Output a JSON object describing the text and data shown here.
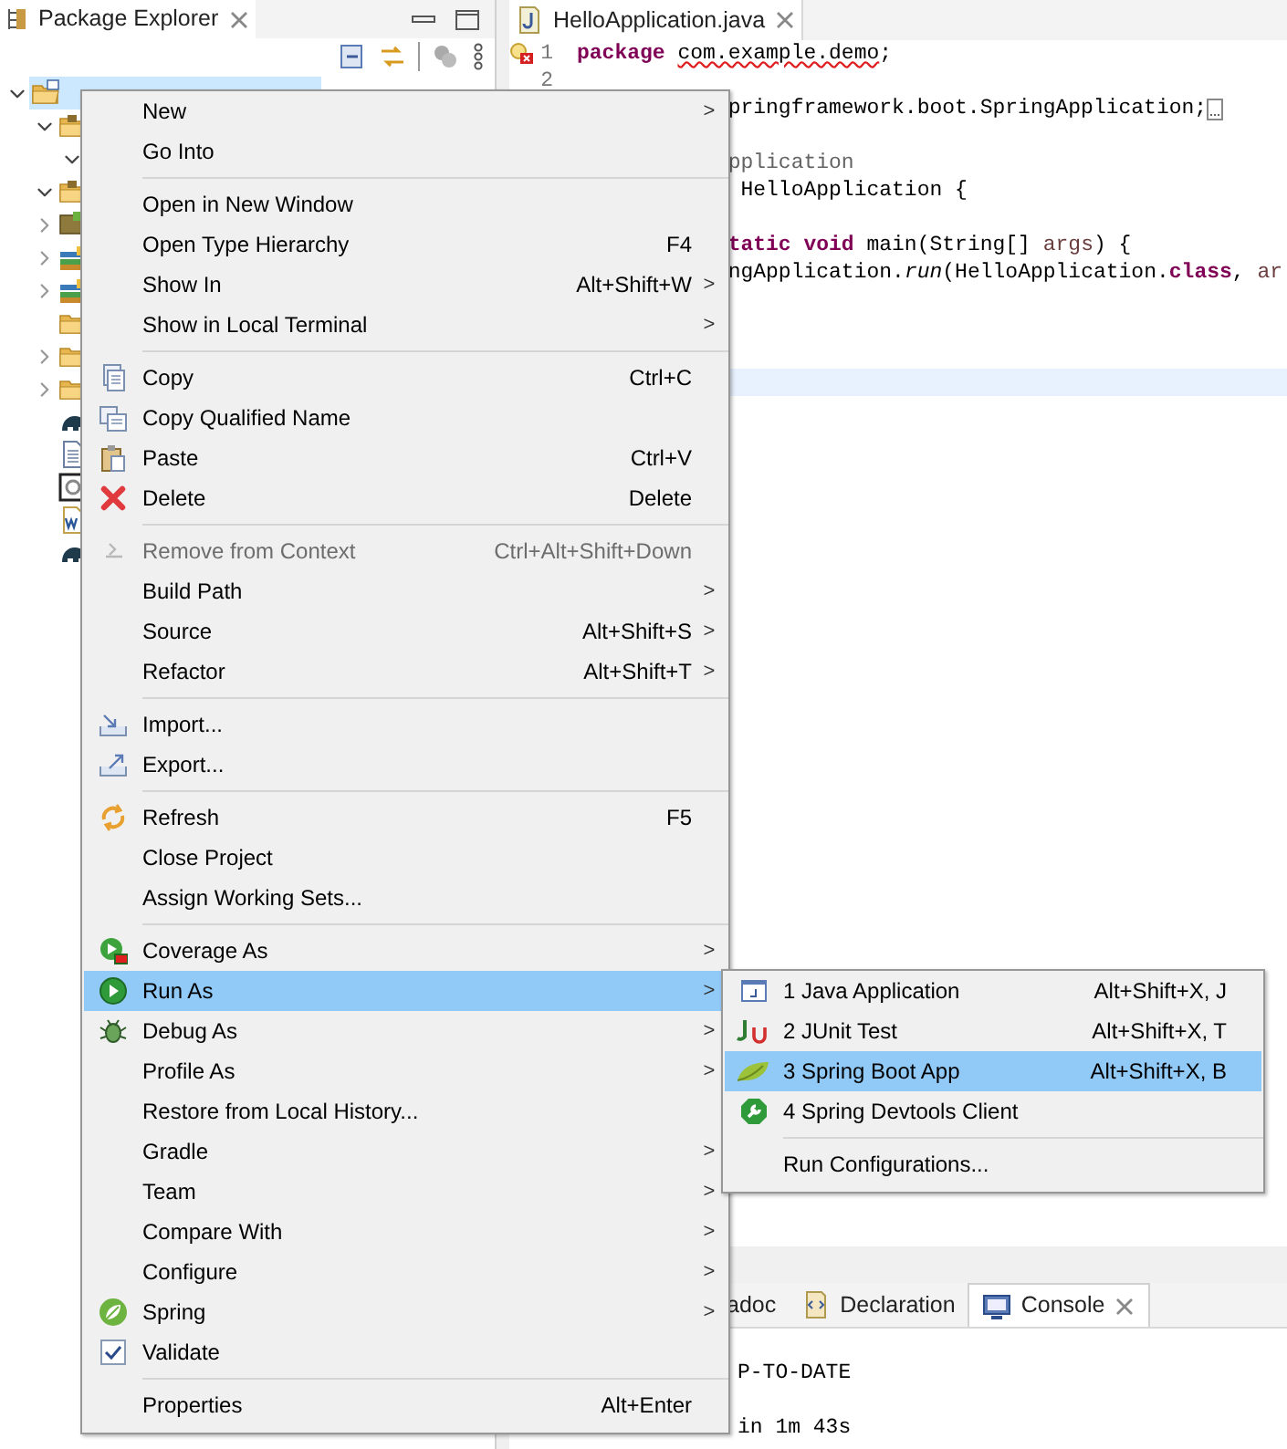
{
  "explorer": {
    "title": "Package Explorer",
    "tree": [
      {
        "kind": "project",
        "expanded": true,
        "selected": true,
        "children": [
          {
            "kind": "source-folder",
            "expanded": true,
            "selected": false,
            "children": [
              {
                "expanded": true
              }
            ]
          },
          {
            "kind": "source-folder",
            "expanded": true,
            "selected": false
          },
          {
            "kind": "jar",
            "expanded": false,
            "selected": false
          },
          {
            "kind": "library",
            "expanded": false,
            "selected": false
          },
          {
            "kind": "library",
            "expanded": false,
            "selected": false
          },
          {
            "kind": "folder",
            "selected": false
          },
          {
            "kind": "folder",
            "expanded": false,
            "selected": false
          },
          {
            "kind": "folder",
            "expanded": false,
            "selected": false
          },
          {
            "kind": "gradle",
            "selected": false
          },
          {
            "kind": "file",
            "selected": false
          },
          {
            "kind": "image-file",
            "selected": false
          },
          {
            "kind": "doc-file",
            "selected": false
          },
          {
            "kind": "gradle",
            "selected": false
          }
        ]
      }
    ]
  },
  "editor": {
    "tab": "HelloApplication.java",
    "lines": [
      {
        "kind": "full",
        "number": "1",
        "problem": true,
        "current": false,
        "tokens": [
          {
            "kind": "keyword",
            "text": "package "
          },
          {
            "kind": "error",
            "text": "com.example.demo"
          },
          {
            "kind": "plain",
            "text": ";"
          }
        ]
      },
      {
        "kind": "full",
        "number": "2",
        "current": false
      },
      {
        "kind": "partial",
        "folded": true,
        "current": false,
        "tokens": [
          {
            "kind": "plain",
            "text": "pringframework.boot.SpringApplication;"
          }
        ]
      },
      {
        "kind": "blank",
        "current": false
      },
      {
        "kind": "partial",
        "current": false,
        "tokens": [
          {
            "kind": "annotation",
            "text": "pplication"
          }
        ]
      },
      {
        "kind": "partial",
        "current": false,
        "tokens": [
          {
            "kind": "plain",
            "text": " HelloApplication {"
          }
        ]
      },
      {
        "kind": "blank",
        "current": false
      },
      {
        "kind": "partial",
        "current": false,
        "tokens": [
          {
            "kind": "keyword",
            "text": "tatic void"
          },
          {
            "kind": "plain",
            "text": " main(String[] "
          },
          {
            "kind": "param",
            "text": "args"
          },
          {
            "kind": "plain",
            "text": ") {"
          }
        ]
      },
      {
        "kind": "partial",
        "current": false,
        "tokens": [
          {
            "kind": "plain",
            "text": "ngApplication."
          },
          {
            "kind": "method",
            "text": "run"
          },
          {
            "kind": "plain",
            "text": "(HelloApplication."
          },
          {
            "kind": "keyword",
            "text": "class"
          },
          {
            "kind": "plain",
            "text": ", "
          },
          {
            "kind": "param",
            "text": "ar"
          }
        ]
      },
      {
        "kind": "blank",
        "current": false
      },
      {
        "kind": "blank",
        "current": false
      },
      {
        "kind": "blank",
        "current": false
      },
      {
        "kind": "blank",
        "current": true
      }
    ]
  },
  "bottom_panel": {
    "tabs": [
      {
        "label": "adoc",
        "selected": false
      },
      {
        "label": "Declaration",
        "selected": false
      },
      {
        "label": "Console",
        "selected": true,
        "closable": true
      }
    ],
    "lines": [
      {
        "kind": "blank"
      },
      {
        "kind": "text",
        "text": "P-TO-DATE"
      },
      {
        "kind": "blank"
      },
      {
        "kind": "text",
        "text": "in 1m 43s"
      }
    ]
  },
  "context_menu": {
    "items": [
      {
        "kind": "item",
        "label": "New",
        "arrow": ">",
        "selected": false
      },
      {
        "kind": "item",
        "label": "Go Into",
        "selected": false
      },
      {
        "kind": "separator"
      },
      {
        "kind": "item",
        "label": "Open in New Window",
        "selected": false
      },
      {
        "kind": "item",
        "label": "Open Type Hierarchy",
        "shortcut": "F4",
        "selected": false
      },
      {
        "kind": "item",
        "label": "Show In",
        "shortcut": "Alt+Shift+W",
        "arrow": ">",
        "selected": false
      },
      {
        "kind": "item",
        "label": "Show in Local Terminal",
        "arrow": ">",
        "selected": false
      },
      {
        "kind": "separator"
      },
      {
        "kind": "item",
        "label": "Copy",
        "shortcut": "Ctrl+C",
        "selected": false
      },
      {
        "kind": "item",
        "label": "Copy Qualified Name",
        "selected": false
      },
      {
        "kind": "item",
        "label": "Paste",
        "shortcut": "Ctrl+V",
        "selected": false
      },
      {
        "kind": "item",
        "label": "Delete",
        "shortcut": "Delete",
        "selected": false
      },
      {
        "kind": "separator"
      },
      {
        "kind": "item",
        "label": "Remove from Context",
        "shortcut": "Ctrl+Alt+Shift+Down",
        "disabled": true,
        "selected": false
      },
      {
        "kind": "item",
        "label": "Build Path",
        "arrow": ">",
        "selected": false
      },
      {
        "kind": "item",
        "label": "Source",
        "shortcut": "Alt+Shift+S",
        "arrow": ">",
        "selected": false
      },
      {
        "kind": "item",
        "label": "Refactor",
        "shortcut": "Alt+Shift+T",
        "arrow": ">",
        "selected": false
      },
      {
        "kind": "separator"
      },
      {
        "kind": "item",
        "label": "Import...",
        "selected": false
      },
      {
        "kind": "item",
        "label": "Export...",
        "selected": false
      },
      {
        "kind": "separator"
      },
      {
        "kind": "item",
        "label": "Refresh",
        "shortcut": "F5",
        "selected": false
      },
      {
        "kind": "item",
        "label": "Close Project",
        "selected": false
      },
      {
        "kind": "item",
        "label": "Assign Working Sets...",
        "selected": false
      },
      {
        "kind": "separator"
      },
      {
        "kind": "item",
        "label": "Coverage As",
        "arrow": ">",
        "selected": false
      },
      {
        "kind": "item",
        "label": "Run As",
        "arrow": ">",
        "selected": true
      },
      {
        "kind": "item",
        "label": "Debug As",
        "arrow": ">",
        "selected": false
      },
      {
        "kind": "item",
        "label": "Profile As",
        "arrow": ">",
        "selected": false
      },
      {
        "kind": "item",
        "label": "Restore from Local History...",
        "selected": false
      },
      {
        "kind": "item",
        "label": "Gradle",
        "arrow": ">",
        "selected": false
      },
      {
        "kind": "item",
        "label": "Team",
        "arrow": ">",
        "selected": false
      },
      {
        "kind": "item",
        "label": "Compare With",
        "arrow": ">",
        "selected": false
      },
      {
        "kind": "item",
        "label": "Configure",
        "arrow": ">",
        "selected": false
      },
      {
        "kind": "item",
        "label": "Spring",
        "arrow": ">",
        "selected": false
      },
      {
        "kind": "item",
        "label": "Validate",
        "selected": false
      },
      {
        "kind": "separator"
      },
      {
        "kind": "item",
        "label": "Properties",
        "shortcut": "Alt+Enter",
        "selected": false
      }
    ]
  },
  "run_as_submenu": {
    "items": [
      {
        "kind": "item",
        "label": "1 Java Application",
        "shortcut": "Alt+Shift+X, J",
        "selected": false
      },
      {
        "kind": "item",
        "label": "2 JUnit Test",
        "shortcut": "Alt+Shift+X, T",
        "selected": false
      },
      {
        "kind": "item",
        "label": "3 Spring Boot App",
        "shortcut": "Alt+Shift+X, B",
        "selected": true
      },
      {
        "kind": "item",
        "label": "4 Spring Devtools Client",
        "selected": false
      },
      {
        "kind": "separator"
      },
      {
        "kind": "item",
        "label": "Run Configurations...",
        "selected": false
      }
    ]
  }
}
